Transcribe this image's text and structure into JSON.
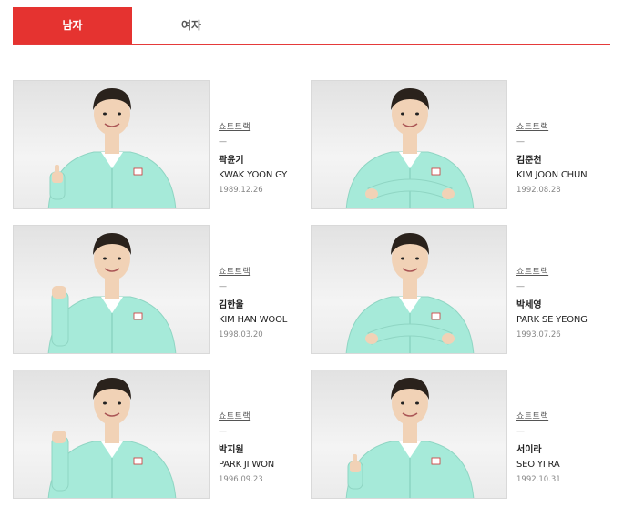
{
  "tabs": [
    {
      "label": "남자",
      "active": true
    },
    {
      "label": "여자",
      "active": false
    }
  ],
  "colors": {
    "accent": "#e53330",
    "jacket": "#a6ead9",
    "hair": "#2a221c",
    "skin": "#f1d2b6"
  },
  "athletes": [
    {
      "sport": "쇼트트랙",
      "dash": "—",
      "name_ko": "곽윤기",
      "name_en": "KWAK YOON GY",
      "dob": "1989.12.26",
      "pose": "thumbs-up"
    },
    {
      "sport": "쇼트트랙",
      "dash": "—",
      "name_ko": "김준천",
      "name_en": "KIM JOON CHUN",
      "dob": "1992.08.28",
      "pose": "arms-crossed"
    },
    {
      "sport": "쇼트트랙",
      "dash": "—",
      "name_ko": "김한울",
      "name_en": "KIM HAN WOOL",
      "dob": "1998.03.20",
      "pose": "fist"
    },
    {
      "sport": "쇼트트랙",
      "dash": "—",
      "name_ko": "박세영",
      "name_en": "PARK SE YEONG",
      "dob": "1993.07.26",
      "pose": "arms-crossed"
    },
    {
      "sport": "쇼트트랙",
      "dash": "—",
      "name_ko": "박지원",
      "name_en": "PARK JI WON",
      "dob": "1996.09.23",
      "pose": "fist"
    },
    {
      "sport": "쇼트트랙",
      "dash": "—",
      "name_ko": "서이라",
      "name_en": "SEO YI RA",
      "dob": "1992.10.31",
      "pose": "thumbs-up"
    }
  ]
}
